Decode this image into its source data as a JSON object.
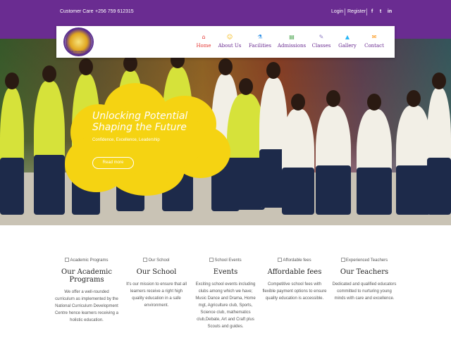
{
  "topbar": {
    "customer_care_label": "Customer Care",
    "phone": "+256 759 612315",
    "login": "Login",
    "register": "Register",
    "social": [
      {
        "icon": "facebook-icon",
        "glyph": "f"
      },
      {
        "icon": "twitter-icon",
        "glyph": "t"
      },
      {
        "icon": "linkedin-icon",
        "glyph": "in"
      }
    ],
    "background_color": "#6a2c91"
  },
  "logo": {
    "alt_text": "THE JOURNEY TO EXCELLENCE"
  },
  "nav": {
    "items": [
      {
        "label": "Home",
        "icon": "home-icon",
        "glyph": "⌂",
        "color": "#e53935",
        "active": true
      },
      {
        "label": "About Us",
        "icon": "people-icon",
        "glyph": "☺",
        "color": "#f4b400",
        "active": false
      },
      {
        "label": "Facilities",
        "icon": "flask-icon",
        "glyph": "⚗",
        "color": "#1e88e5",
        "active": false
      },
      {
        "label": "Admissions",
        "icon": "book-icon",
        "glyph": "▤",
        "color": "#43a047",
        "active": false
      },
      {
        "label": "Classes",
        "icon": "pencil-icon",
        "glyph": "✎",
        "color": "#8e7cc3",
        "active": false
      },
      {
        "label": "Gallery",
        "icon": "graduation-cap-icon",
        "glyph": "▲",
        "color": "#29b6f6",
        "active": false
      },
      {
        "label": "Contact",
        "icon": "envelope-icon",
        "glyph": "✉",
        "color": "#fb8c00",
        "active": false
      }
    ]
  },
  "hero": {
    "title_line1": "Unlocking Potential",
    "title_line2": "Shaping the Future",
    "subtitle": "Confidence, Excellence, Leadership",
    "button": "Read more",
    "cloud_color": "#f5d312"
  },
  "features": [
    {
      "alt": "Academic Programs",
      "title": "Our Academic Programs",
      "text": "We offer a well-rounded curriculum as implemented by the National Curriculum Development Centre hence learners receiving a holistic education."
    },
    {
      "alt": "Our School",
      "title": "Our School",
      "text": "It's our mission to ensure that all learners receive a right high quality education in a safe environment."
    },
    {
      "alt": "School Events",
      "title": "Events",
      "text": "Exciting school events including clubs among which we have; Music Dance and Drama, Home mgt, Agriculture club, Sports, Science club, mathematics club,Debate, Art and Craft plus Scouts and guides."
    },
    {
      "alt": "Affordable fees",
      "title": "Affordable fees",
      "text": "Competitive school fees with flexible payment options to ensure quality education is accessible."
    },
    {
      "alt": "Experienced Teachers",
      "title": "Our Teachers",
      "text": "Dedicated and qualified educators committed to nurturing young minds with care and excellence."
    }
  ]
}
